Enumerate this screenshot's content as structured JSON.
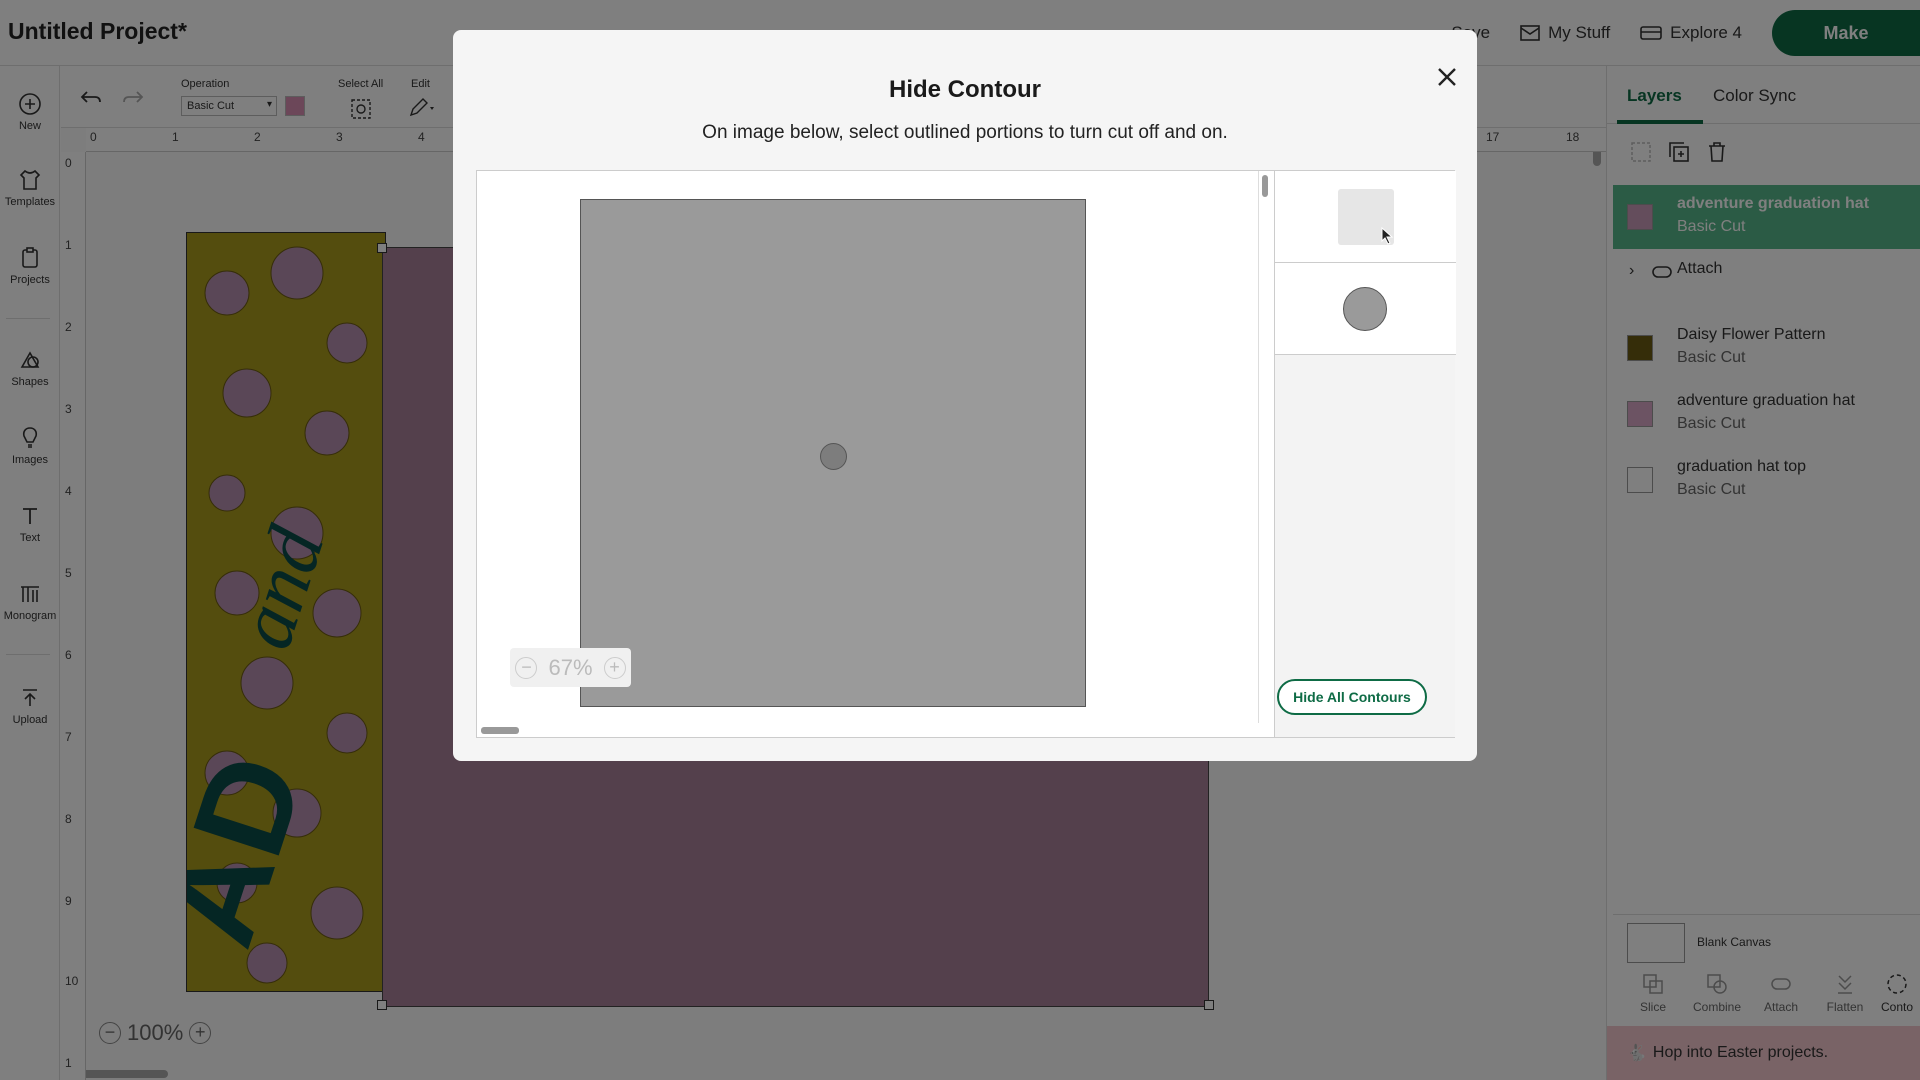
{
  "app": {
    "project_title": "Untitled Project*",
    "save_label": "Save",
    "mystuff_label": "My Stuff",
    "explore_label": "Explore 4",
    "make_label": "Make"
  },
  "leftrail": {
    "new": "New",
    "templates": "Templates",
    "projects": "Projects",
    "shapes": "Shapes",
    "images": "Images",
    "text": "Text",
    "monogram": "Monogram",
    "upload": "Upload"
  },
  "toolbar": {
    "operation_label": "Operation",
    "operation_value": "Basic Cut",
    "select_all_label": "Select All",
    "edit_label": "Edit"
  },
  "canvas": {
    "ruler_h": [
      "0",
      "1",
      "2",
      "3",
      "4",
      "17",
      "18"
    ],
    "ruler_v": [
      "0",
      "1",
      "2",
      "3",
      "4",
      "5",
      "6",
      "7",
      "8",
      "9",
      "10",
      "1"
    ],
    "zoom_value": "100%",
    "colors": {
      "flower": "#a99a1c",
      "purple_sheet": "#a98098",
      "text_teal": "#0a4c48"
    }
  },
  "rightpanel": {
    "tabs": [
      "Layers",
      "Color Sync"
    ],
    "layers": [
      {
        "name": "adventure graduation hat",
        "sub": "Basic Cut",
        "selected": true
      },
      {
        "name": "Attach",
        "sub": ""
      },
      {
        "name": "Daisy Flower Pattern",
        "sub": "Basic Cut"
      },
      {
        "name": "adventure graduation hat",
        "sub": "Basic Cut"
      },
      {
        "name": "graduation hat top",
        "sub": "Basic Cut"
      }
    ],
    "blank_canvas": "Blank Canvas",
    "bottom_tools": [
      "Slice",
      "Combine",
      "Attach",
      "Flatten",
      "Conto"
    ],
    "promo": "Hop into Easter projects."
  },
  "modal": {
    "title": "Hide Contour",
    "description": "On image below, select outlined portions to turn cut off and on.",
    "zoom_value": "67%",
    "hide_all_label": "Hide All Contours"
  }
}
